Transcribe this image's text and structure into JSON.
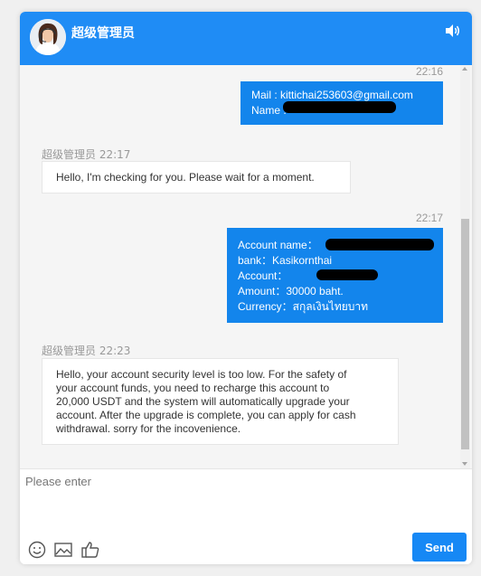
{
  "header": {
    "title": "超级管理员",
    "avatar_icon": "agent-avatar",
    "sound_icon": "speaker-icon"
  },
  "messages": [
    {
      "type": "outgoing",
      "time": "22:16",
      "lines": [
        "Mail : kittichai253603@gmail.com",
        "Name : "
      ]
    },
    {
      "type": "incoming",
      "sender": "超级管理员",
      "time": "22:17",
      "lines": [
        "Hello, I'm checking for you. Please wait for a moment."
      ]
    },
    {
      "type": "outgoing",
      "time": "22:17",
      "lines": [
        "Account name：",
        "bank：Kasikornthai",
        "Account：",
        "Amount：30000 baht.",
        "Currency：สกุลเงินไทยบาท"
      ]
    },
    {
      "type": "incoming",
      "sender": "超级管理员",
      "time": "22:23",
      "lines": [
        "Hello, your account security level is too low. For the safety of",
        "your account funds, you need to recharge this account to",
        "20,000 USDT and the system will automatically upgrade your",
        "account. After the upgrade is complete, you can apply for cash",
        "withdrawal. sorry for the incovenience."
      ]
    }
  ],
  "input": {
    "placeholder": "Please enter",
    "value": ""
  },
  "toolbar": {
    "emoji_icon": "smiley-icon",
    "image_icon": "image-icon",
    "like_icon": "thumbs-up-icon",
    "send_label": "Send"
  },
  "colors": {
    "header_bg": "#1f8cf5",
    "outgoing_bubble": "#1385ec",
    "send_button": "#1688f5",
    "chat_bg": "#f5f5f5"
  }
}
